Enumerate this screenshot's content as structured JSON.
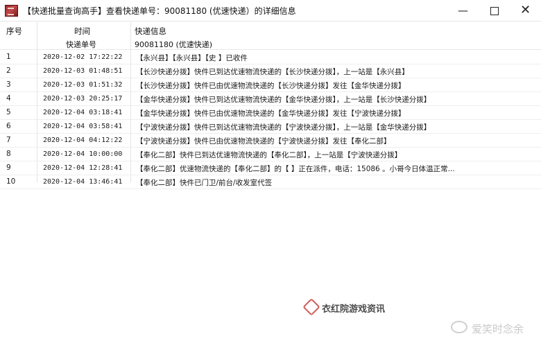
{
  "window": {
    "title": "【快递批量查询高手】查看快递单号：90081180    (优速快递）的详细信息",
    "minimize": "—",
    "close": "✕"
  },
  "table": {
    "headers": {
      "index": "序号",
      "time": "时间",
      "info": "快递信息",
      "tracking_no_label": "快递单号",
      "tracking_no_value": "90081180    (优速快递)"
    },
    "rows": [
      {
        "no": "1",
        "time": "2020-12-02 17:22:22",
        "info": "【永兴县】【永兴县】【史    】已收件"
      },
      {
        "no": "2",
        "time": "2020-12-03 01:48:51",
        "info": "【长沙快递分拨】快件已到达优速物流快递的【长沙快递分拨】，上一站是【永兴县】"
      },
      {
        "no": "3",
        "time": "2020-12-03 01:51:32",
        "info": "【长沙快递分拨】快件已由优速物流快递的【长沙快递分拨】发往【金华快递分拨】"
      },
      {
        "no": "4",
        "time": "2020-12-03 20:25:17",
        "info": "【金华快递分拨】快件已到达优速物流快递的【金华快递分拨】，上一站是【长沙快递分拨】"
      },
      {
        "no": "5",
        "time": "2020-12-04 03:18:41",
        "info": "【金华快递分拨】快件已由优速物流快递的【金华快递分拨】发往【宁波快递分拨】"
      },
      {
        "no": "6",
        "time": "2020-12-04 03:58:41",
        "info": "【宁波快递分拨】快件已到达优速物流快递的【宁波快递分拨】，上一站是【金华快递分拨】"
      },
      {
        "no": "7",
        "time": "2020-12-04 04:12:22",
        "info": "【宁波快递分拨】快件已由优速物流快递的【宁波快递分拨】发往【奉化二部】"
      },
      {
        "no": "8",
        "time": "2020-12-04 10:00:00",
        "info": "【奉化二部】快件已到达优速物流快递的【奉化二部】，上一站是【宁波快递分拨】"
      },
      {
        "no": "9",
        "time": "2020-12-04 12:28:41",
        "info": "【奉化二部】优速物流快递的【奉化二部】的【    】正在派件，电话：15086      。小哥今日体温正常..."
      },
      {
        "no": "10",
        "time": "2020-12-04 13:46:41",
        "info": "【奉化二部】快件已门卫/前台/收发室代签"
      }
    ]
  },
  "watermarks": {
    "site": "衣红院游戏资讯",
    "weibo": "爱笑时念余"
  }
}
